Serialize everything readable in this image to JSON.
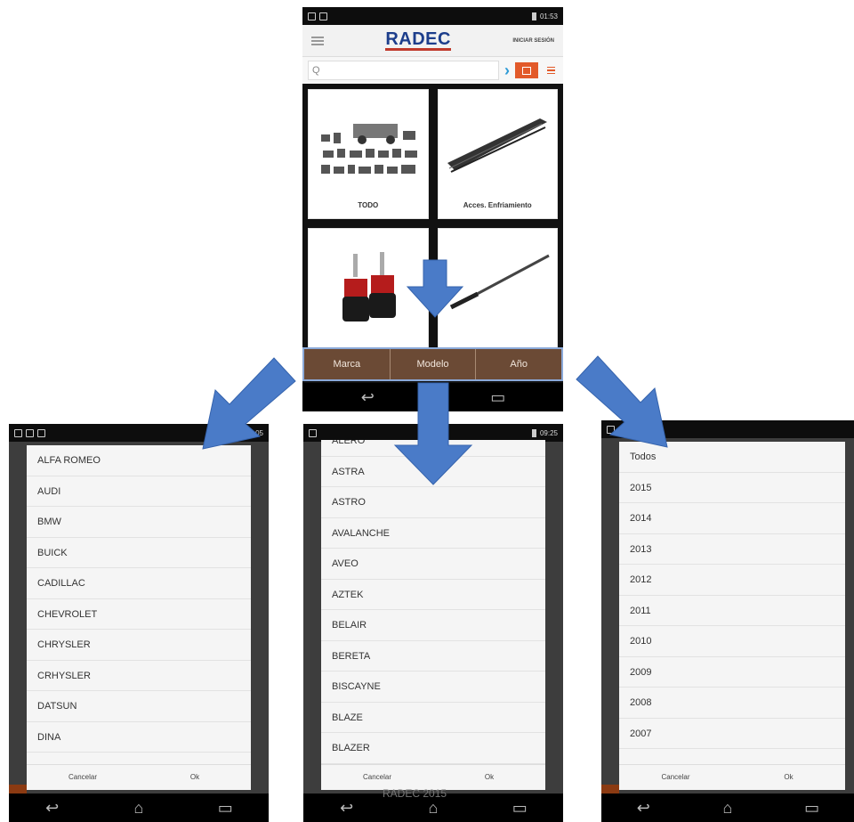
{
  "main_screen": {
    "status_time": "01:53",
    "logo": "RADEC",
    "login_label": "INICIAR SESIÓN",
    "search_placeholder": "Q",
    "cards": [
      {
        "label": "TODO"
      },
      {
        "label": "Acces. Enfriamiento"
      },
      {
        "label": ""
      },
      {
        "label": ""
      }
    ],
    "filters": [
      "Marca",
      "Modelo",
      "Año"
    ]
  },
  "marca_dialog": {
    "status_time": "05",
    "options": [
      "ALFA ROMEO",
      "AUDI",
      "BMW",
      "BUICK",
      "CADILLAC",
      "CHEVROLET",
      "CHRYSLER",
      "CRHYSLER",
      "DATSUN",
      "DINA"
    ],
    "cancel": "Cancelar",
    "ok": "Ok"
  },
  "modelo_dialog": {
    "status_time": "09:25",
    "options": [
      "ALERO",
      "ASTRA",
      "ASTRO",
      "AVALANCHE",
      "AVEO",
      "AZTEK",
      "BELAIR",
      "BERETA",
      "BISCAYNE",
      "BLAZE",
      "BLAZER"
    ],
    "cancel": "Cancelar",
    "ok": "Ok"
  },
  "anio_dialog": {
    "options": [
      "Todos",
      "2015",
      "2014",
      "2013",
      "2012",
      "2011",
      "2010",
      "2009",
      "2008",
      "2007"
    ],
    "cancel": "Cancelar",
    "ok": "Ok"
  },
  "watermark": "RADEC 2015",
  "colors": {
    "arrow": "#4a7bc8",
    "filter_bar": "#6b4a35",
    "logo": "#1d3e8c",
    "accent": "#e25a2a"
  }
}
